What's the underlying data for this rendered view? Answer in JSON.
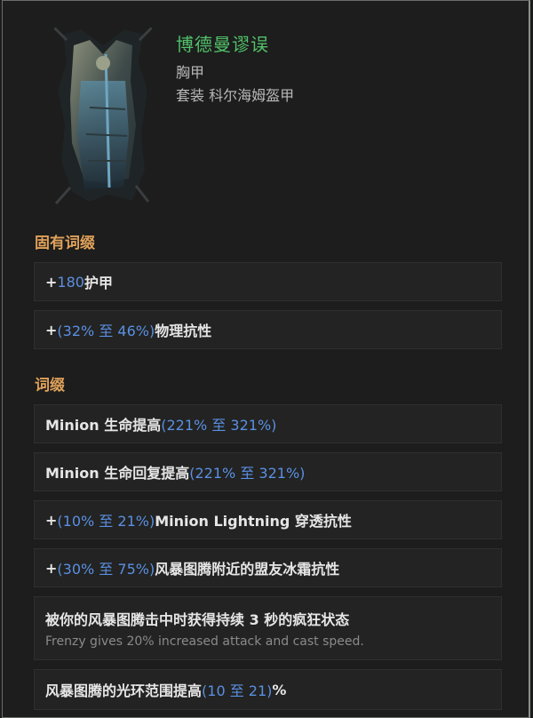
{
  "item": {
    "name": "博德曼谬误",
    "type": "胸甲",
    "set": "套装 科尔海姆盔甲"
  },
  "implicit": {
    "title": "固有词缀",
    "rows": [
      {
        "pre": "+",
        "val": "180",
        "mid": "",
        "val2": "",
        "post": " 护甲"
      },
      {
        "pre": "+",
        "val": "(32% 至 46%)",
        "mid": "",
        "val2": "",
        "post": " 物理抗性"
      }
    ]
  },
  "affixes": {
    "title": "词缀",
    "rows": [
      {
        "text": "Minion 生命提高",
        "val": "(221% 至 321%)"
      },
      {
        "text": "Minion 生命回复提高",
        "val": "(221% 至 321%)"
      },
      {
        "pre": "+",
        "val": "(10% 至 21%)",
        "text": " Minion Lightning 穿透抗性"
      },
      {
        "pre": "+",
        "val": "(30% 至 75%)",
        "text": " 风暴图腾附近的盟友冰霜抗性"
      },
      {
        "text": "被你的风暴图腾击中时获得持续 3 秒的疯狂状态",
        "sub": "Frenzy gives 20% increased attack and cast speed."
      },
      {
        "text": "风暴图腾的光环范围提高 ",
        "val": "(10 至 21)",
        "post": "%"
      }
    ]
  },
  "colors": {
    "name": "#52c06a",
    "section": "#e0a15a",
    "value": "#5b8fe2"
  }
}
